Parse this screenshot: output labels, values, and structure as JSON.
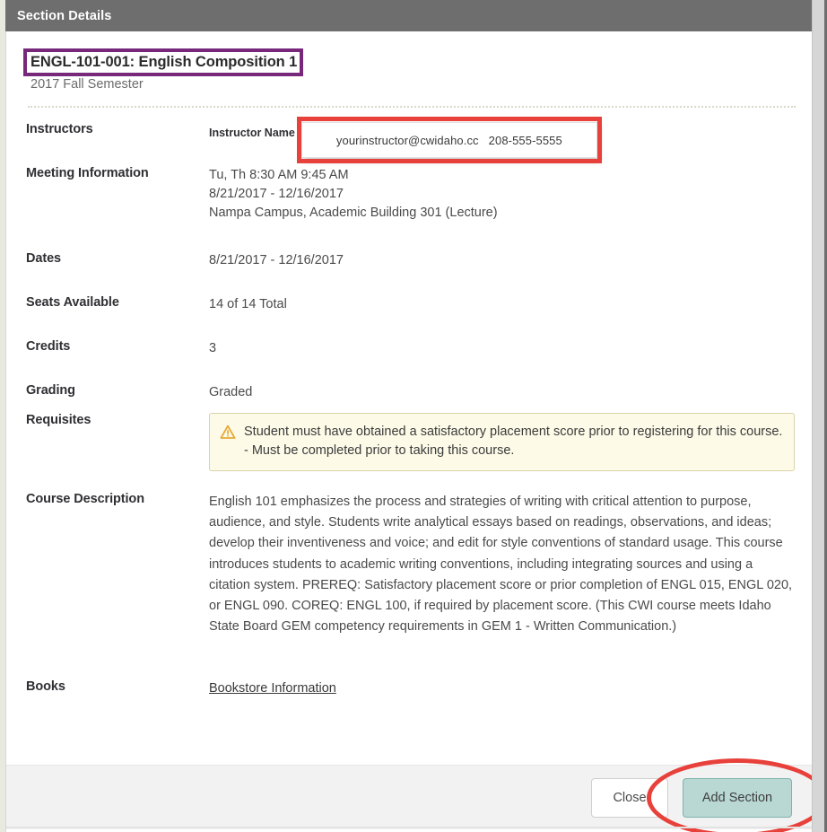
{
  "window": {
    "title": "Section Details"
  },
  "course": {
    "title": "ENGL-101-001: English Composition 1",
    "term": "2017 Fall Semester"
  },
  "details": {
    "instructors": {
      "label": "Instructors",
      "name": "Instructor Name",
      "email": "yourinstructor@cwidaho.cc",
      "phone": "208-555-5555"
    },
    "meeting": {
      "label": "Meeting Information",
      "line1": "Tu, Th 8:30 AM 9:45 AM",
      "line2": "8/21/2017 - 12/16/2017",
      "line3": "Nampa Campus, Academic Building 301 (Lecture)"
    },
    "dates": {
      "label": "Dates",
      "value": "8/21/2017 - 12/16/2017"
    },
    "seats": {
      "label": "Seats Available",
      "value": "14 of 14 Total"
    },
    "credits": {
      "label": "Credits",
      "value": "3"
    },
    "grading": {
      "label": "Grading",
      "value": "Graded"
    },
    "requisites": {
      "label": "Requisites",
      "warning_icon": "warning-triangle-icon",
      "text": "Student must have obtained a satisfactory placement score prior to registering for this course. - Must be completed prior to taking this course."
    },
    "description": {
      "label": "Course Description",
      "text": "English 101 emphasizes the process and strategies of writing with critical attention to purpose, audience, and style. Students write analytical essays based on readings, observations, and ideas; develop their inventiveness and voice; and edit for style conventions of standard usage. This course introduces students to academic writing conventions, including integrating sources and using a citation system. PREREQ: Satisfactory placement score or prior completion of ENGL 015, ENGL 020, or ENGL 090. COREQ: ENGL 100, if required by placement score. (This CWI course meets Idaho State Board GEM competency requirements in GEM 1 - Written Communication.)"
    },
    "books": {
      "label": "Books",
      "link_text": "Bookstore Information"
    }
  },
  "footer": {
    "close_label": "Close",
    "add_section_label": "Add Section"
  },
  "colors": {
    "titlebar": "#6e6e6e",
    "annotation_purple": "#77287b",
    "annotation_red": "#e8403a",
    "add_section_teal": "#b9d8d4",
    "alert_background": "#fdfbe8",
    "alert_border": "#d7d4a8",
    "warning_icon": "#e8a838"
  }
}
